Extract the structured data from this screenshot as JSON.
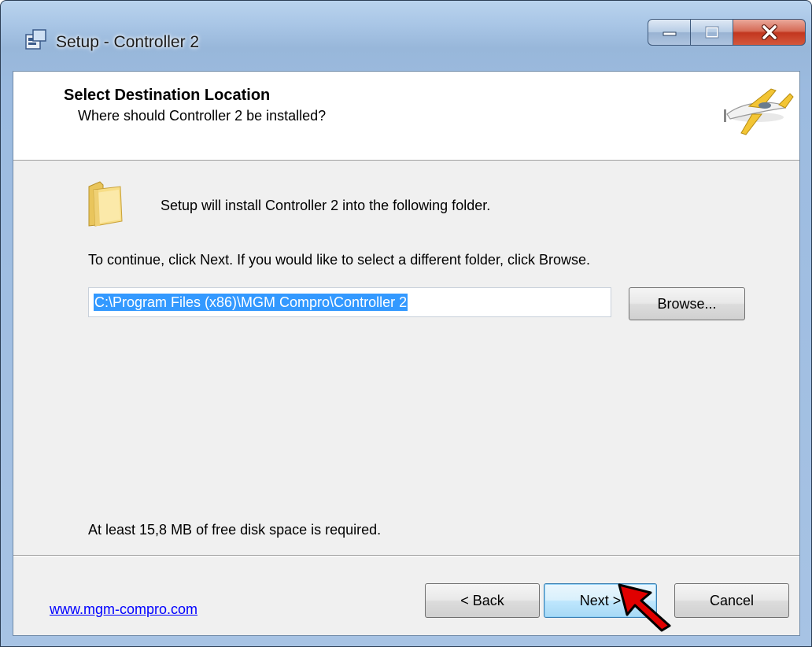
{
  "window": {
    "title": "Setup - Controller 2"
  },
  "header": {
    "title": "Select Destination Location",
    "subtitle": "Where should Controller 2 be installed?"
  },
  "body": {
    "install_text": "Setup will install Controller 2 into the following folder.",
    "instruction": "To continue, click Next. If you would like to select a different folder, click Browse.",
    "path_value": "C:\\Program Files (x86)\\MGM Compro\\Controller 2",
    "browse_label": "Browse...",
    "disk_space_text": "At least 15,8 MB of free disk space is required."
  },
  "footer": {
    "link_text": "www.mgm-compro.com",
    "back_label": "< Back",
    "next_label": "Next >",
    "cancel_label": "Cancel"
  },
  "icons": {
    "app": "setup-icon",
    "header_image": "airplane-icon",
    "folder": "folder-icon",
    "annotation": "red-arrow-pointer"
  },
  "colors": {
    "selection": "#3399ff",
    "link": "#0000ff",
    "close_button": "#c2361f",
    "arrow": "#e00000"
  }
}
